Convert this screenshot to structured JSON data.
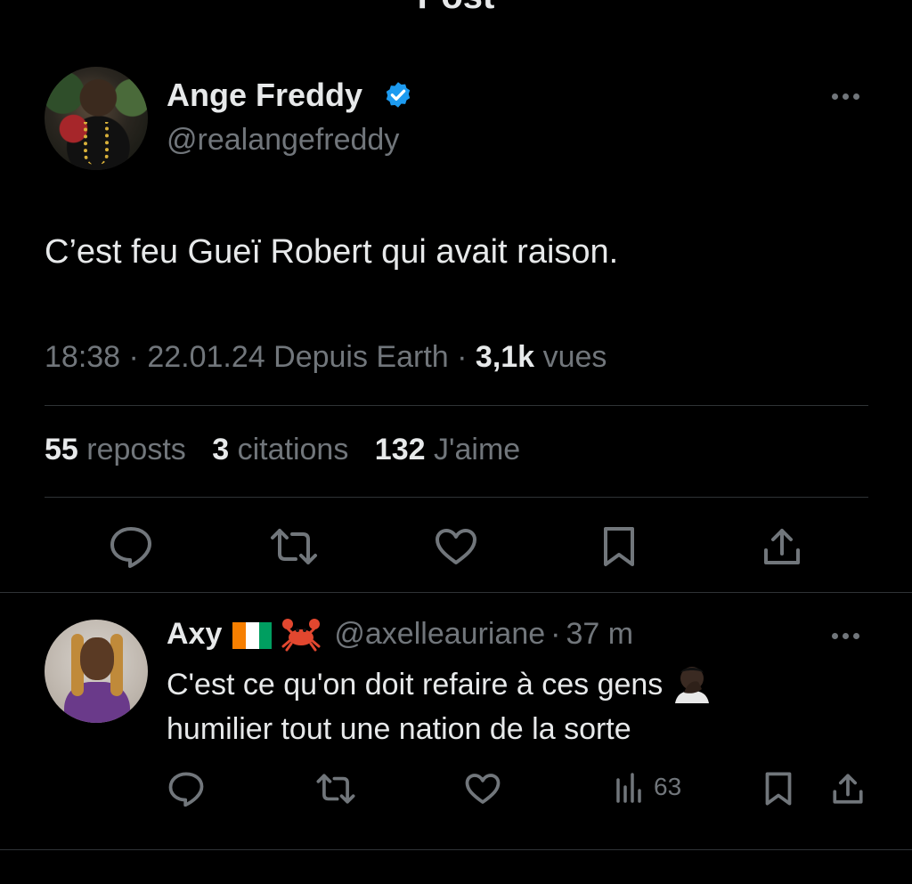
{
  "header": {
    "title": "Post"
  },
  "post": {
    "author_name": "Ange Freddy",
    "author_handle": "@realangefreddy",
    "text": "C’est feu Gueï Robert qui avait raison.",
    "time": "18:38",
    "date": "22.01.24",
    "source": "Depuis Earth",
    "separator": "·",
    "views_count": "3,1k",
    "views_label": "vues",
    "reposts_count": "55",
    "reposts_label": "reposts",
    "quotes_count": "3",
    "quotes_label": "citations",
    "likes_count": "132",
    "likes_label": "J'aime"
  },
  "reply": {
    "author_name": "Axy",
    "author_handle": "@axelleauriane",
    "separator": "·",
    "time_ago": "37 m",
    "line1": "C'est ce qu'on doit refaire à ces gens",
    "line2": "humilier tout une nation de la sorte",
    "views": "63"
  },
  "colors": {
    "background": "#000000",
    "text_primary": "#e7e9ea",
    "text_secondary": "#71767b",
    "divider": "#2f3336",
    "verified": "#1d9bf0",
    "flag_orange": "#f77f00",
    "flag_white": "#ffffff",
    "flag_green": "#009e60",
    "crab_red": "#e2472f"
  }
}
